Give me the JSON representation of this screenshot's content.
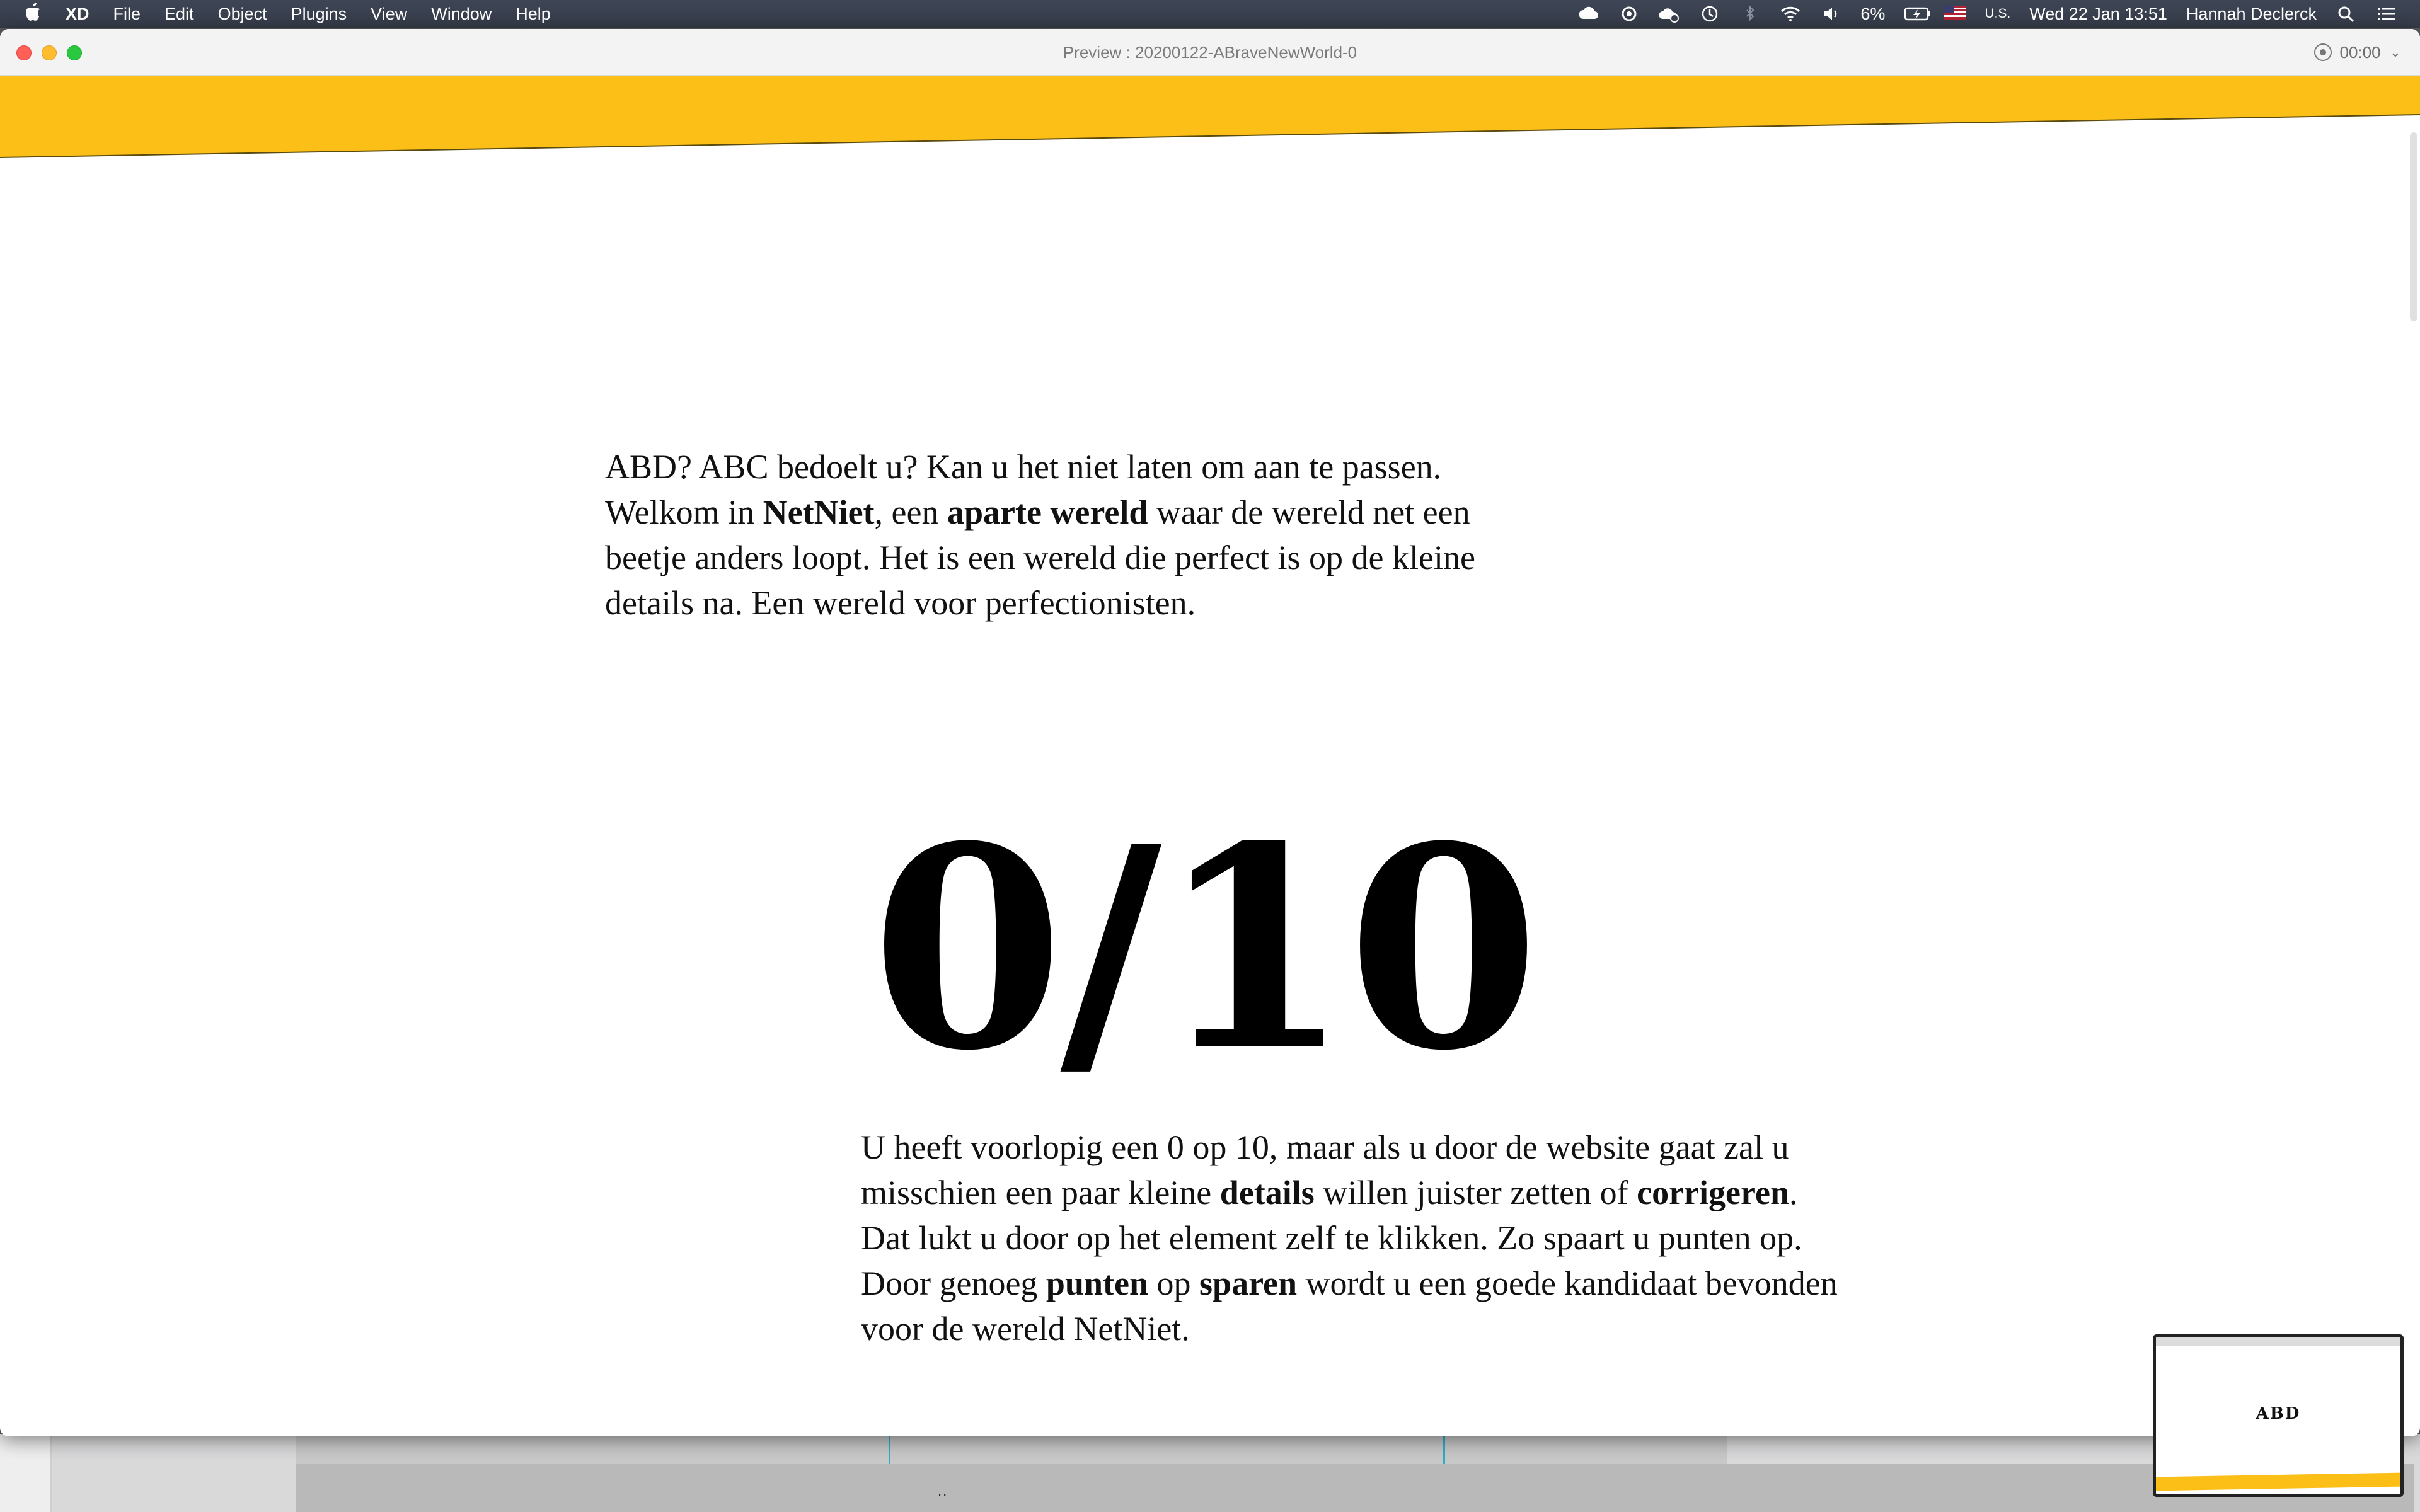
{
  "menubar": {
    "app_name": "XD",
    "menus": [
      "File",
      "Edit",
      "Object",
      "Plugins",
      "View",
      "Window",
      "Help"
    ],
    "battery": "6%",
    "input_source": "U.S.",
    "datetime": "Wed 22 Jan  13:51",
    "user": "Hannah Declerck"
  },
  "window": {
    "title": "Preview : 20200122-ABraveNewWorld-0",
    "timer": "00:00"
  },
  "colors": {
    "accent_yellow": "#fbbf17",
    "text": "#111111"
  },
  "content": {
    "intro": {
      "p1": "ABD? ABC bedoelt u? Kan u het niet laten om aan te passen. Welkom in ",
      "b1": "NetNiet",
      "p2": ", een ",
      "b2": "aparte wereld",
      "p3": " waar de wereld net een beetje anders loopt. Het is een wereld die perfect is op de kleine details na. Een wereld voor perfectionisten."
    },
    "score": "0/10",
    "explain": {
      "p1": "U heeft voorlopig een 0 op 10, maar als u door de website gaat zal u misschien een paar kleine ",
      "b1": "details",
      "p2": " willen juister zetten of ",
      "b2": "corrigeren",
      "p3": ". Dat lukt u door op het element zelf te klikken. Zo spaart u punten op. Door genoeg ",
      "b3": "punten",
      "p4": " op ",
      "b4": "sparen",
      "p5": " wordt u een goede kandidaat bevonden voor de wereld NetNiet."
    }
  },
  "thumbnail": {
    "label": "ABD"
  },
  "footer": {
    "dots": ".."
  }
}
